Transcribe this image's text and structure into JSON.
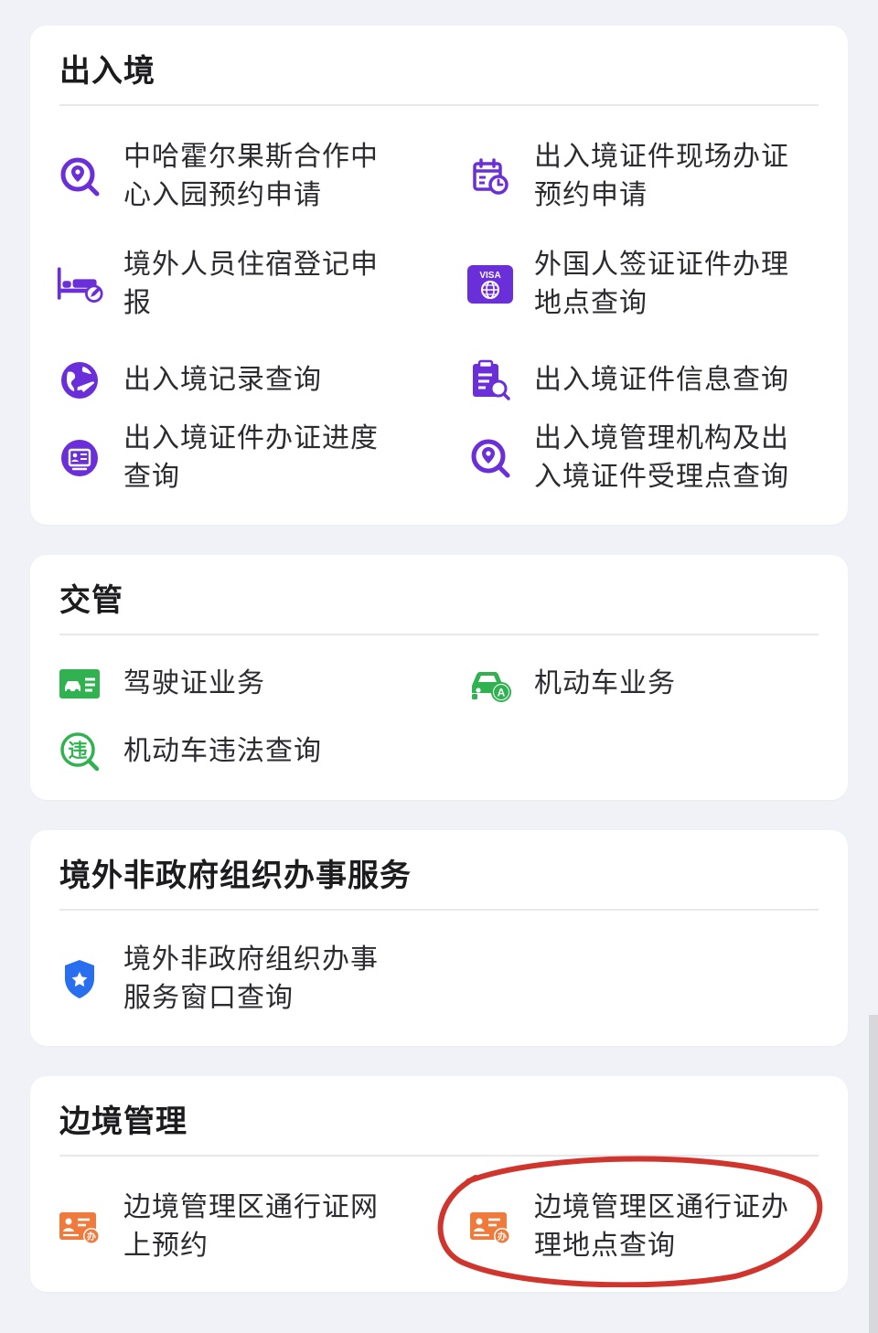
{
  "colors": {
    "purple": "#6a2fd8",
    "green": "#2fb24f",
    "blue": "#2a6ef0",
    "orange": "#f07a3c",
    "highlight": "#d0352d"
  },
  "sections": [
    {
      "title": "出入境",
      "items": [
        {
          "label": "中哈霍尔果斯合作中心入园预约申请",
          "icon": "location-search-icon"
        },
        {
          "label": "出入境证件现场办证预约申请",
          "icon": "calendar-clock-icon"
        },
        {
          "label": "境外人员住宿登记申报",
          "icon": "bed-edit-icon"
        },
        {
          "label": "外国人签证证件办理地点查询",
          "icon": "visa-globe-icon"
        },
        {
          "label": "出入境记录查询",
          "icon": "globe-plane-icon"
        },
        {
          "label": "出入境证件信息查询",
          "icon": "clipboard-search-icon"
        },
        {
          "label": "出入境证件办证进度查询",
          "icon": "id-card-progress-icon"
        },
        {
          "label": "出入境管理机构及出入境证件受理点查询",
          "icon": "location-search-icon"
        }
      ]
    },
    {
      "title": "交管",
      "items": [
        {
          "label": "驾驶证业务",
          "icon": "driver-license-icon"
        },
        {
          "label": "机动车业务",
          "icon": "car-a-icon"
        },
        {
          "label": "机动车违法查询",
          "icon": "violation-search-icon",
          "icon_char": "违"
        }
      ]
    },
    {
      "title": "境外非政府组织办事服务",
      "items": [
        {
          "label": "境外非政府组织办事服务窗口查询",
          "icon": "shield-star-icon"
        }
      ]
    },
    {
      "title": "边境管理",
      "items": [
        {
          "label": "边境管理区通行证网上预约",
          "icon": "pass-card-icon",
          "icon_char": "办"
        },
        {
          "label": "边境管理区通行证办理地点查询",
          "icon": "pass-card-icon",
          "icon_char": "办"
        }
      ]
    }
  ]
}
